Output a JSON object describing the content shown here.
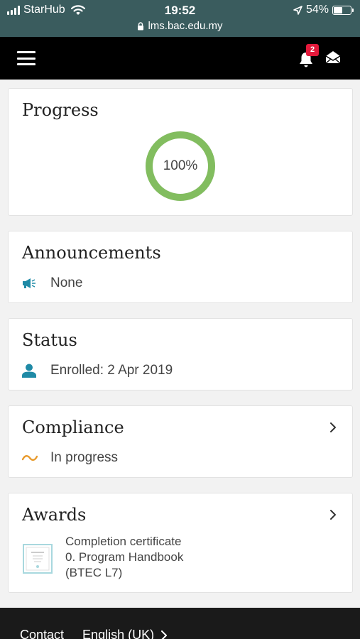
{
  "status_bar": {
    "carrier": "StarHub",
    "time": "19:52",
    "battery": "54%",
    "battery_level": 0.54,
    "url": "lms.bac.edu.my"
  },
  "nav": {
    "notification_count": "2"
  },
  "progress": {
    "title": "Progress",
    "percent_label": "100%",
    "percent_value": 100,
    "ring_color": "#82bd5f"
  },
  "announcements": {
    "title": "Announcements",
    "value": "None"
  },
  "status": {
    "title": "Status",
    "value": "Enrolled: 2 Apr 2019"
  },
  "compliance": {
    "title": "Compliance",
    "value": "In progress",
    "icon_color": "#e89a2c"
  },
  "awards": {
    "title": "Awards",
    "line1": "Completion certificate",
    "line2": "0. Program Handbook",
    "line3": "(BTEC L7)"
  },
  "footer": {
    "contact": "Contact",
    "language": "English (UK)"
  },
  "colors": {
    "accent_teal": "#1f8aa6",
    "status_bar": "#3a5c5e",
    "badge": "#e3193b"
  }
}
